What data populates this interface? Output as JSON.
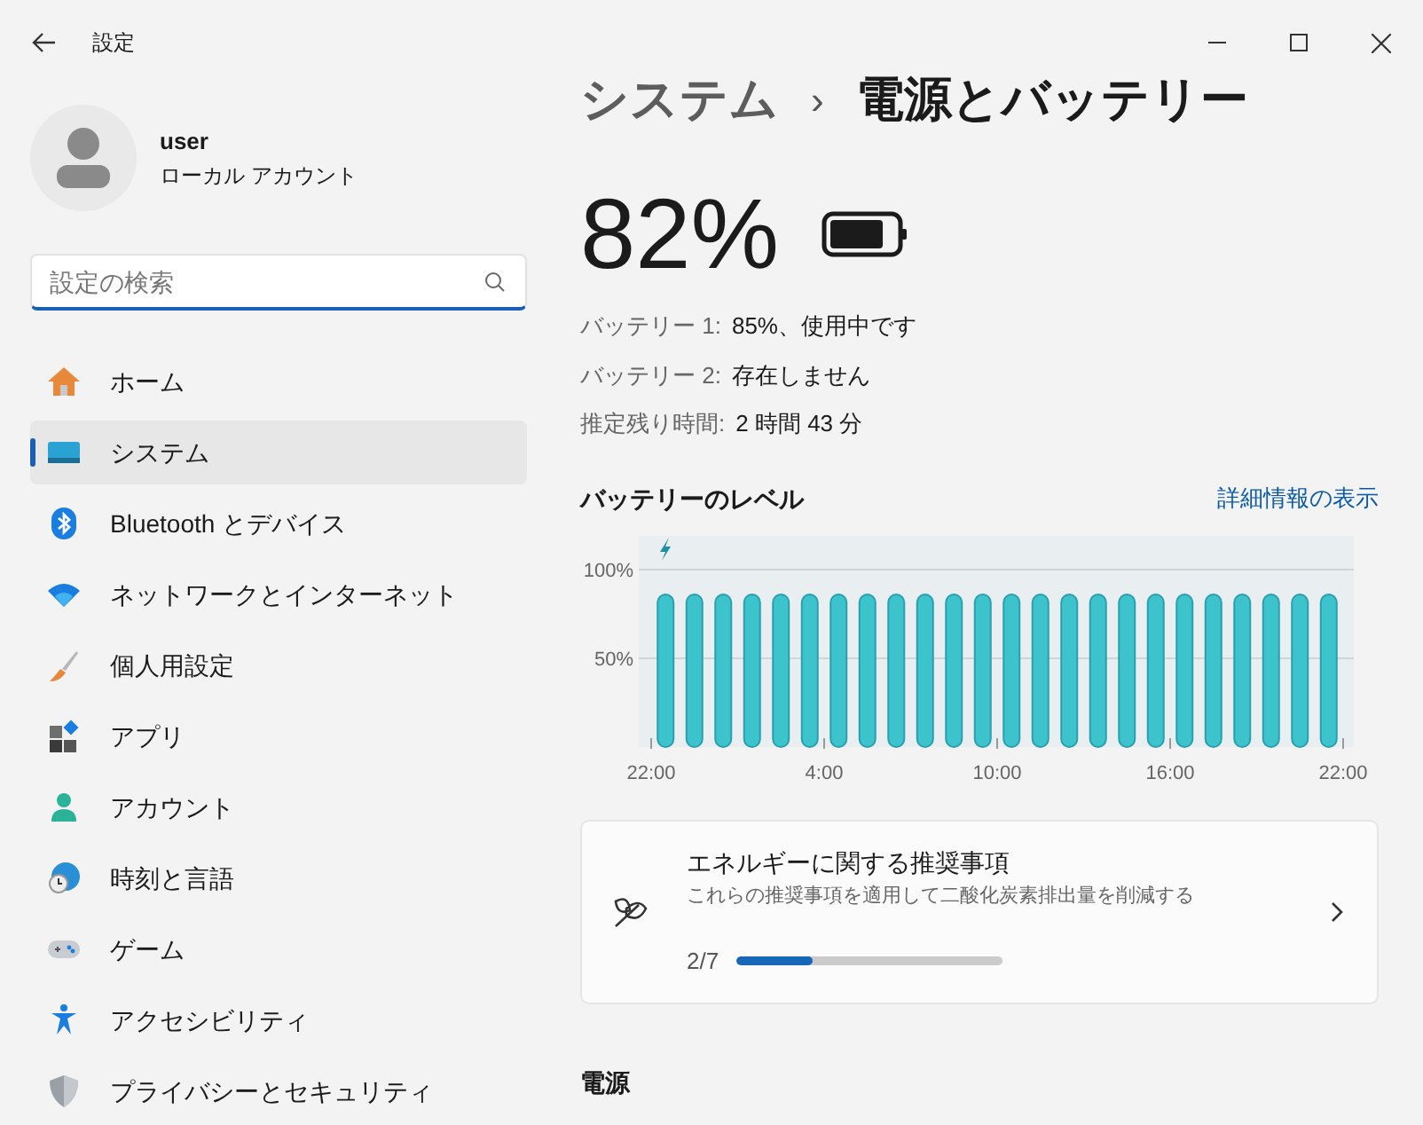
{
  "window": {
    "title": "設定"
  },
  "account": {
    "name": "user",
    "type": "ローカル アカウント"
  },
  "search": {
    "placeholder": "設定の検索"
  },
  "sidebar": {
    "items": [
      {
        "label": "ホーム",
        "selected": false
      },
      {
        "label": "システム",
        "selected": true
      },
      {
        "label": "Bluetooth とデバイス",
        "selected": false
      },
      {
        "label": "ネットワークとインターネット",
        "selected": false
      },
      {
        "label": "個人用設定",
        "selected": false
      },
      {
        "label": "アプリ",
        "selected": false
      },
      {
        "label": "アカウント",
        "selected": false
      },
      {
        "label": "時刻と言語",
        "selected": false
      },
      {
        "label": "ゲーム",
        "selected": false
      },
      {
        "label": "アクセシビリティ",
        "selected": false
      },
      {
        "label": "プライバシーとセキュリティ",
        "selected": false
      }
    ]
  },
  "breadcrumb": {
    "parent": "システム",
    "separator": "›",
    "current": "電源とバッテリー"
  },
  "battery": {
    "percent": "82%",
    "level": 0.82,
    "details": [
      {
        "label": "バッテリー 1:",
        "value": "85%、使用中です"
      },
      {
        "label": "バッテリー 2:",
        "value": "存在しません"
      },
      {
        "label": "推定残り時間:",
        "value": "2 時間 43 分"
      }
    ]
  },
  "battery_level": {
    "title": "バッテリーのレベル",
    "link": "詳細情報の表示",
    "chart_data": {
      "type": "bar",
      "ylim": [
        0,
        100
      ],
      "categories": [
        "22:00",
        null,
        null,
        null,
        null,
        null,
        "4:00",
        null,
        null,
        null,
        null,
        null,
        "10:00",
        null,
        null,
        null,
        null,
        null,
        "16:00",
        null,
        null,
        null,
        null,
        null,
        "22:00"
      ],
      "values": [
        86,
        86,
        86,
        86,
        86,
        86,
        86,
        86,
        86,
        86,
        86,
        86,
        86,
        86,
        86,
        86,
        86,
        86,
        86,
        86,
        86,
        86,
        86,
        86,
        null
      ],
      "yticks": [
        {
          "value": 50,
          "label": "50%"
        },
        {
          "value": 100,
          "label": "100%"
        }
      ]
    }
  },
  "recommendations": {
    "title": "エネルギーに関する推奨事項",
    "subtitle": "これらの推奨事項を適用して二酸化炭素排出量を削減する",
    "progress": "2/7",
    "level": 0.286
  },
  "power_section": {
    "title": "電源"
  }
}
